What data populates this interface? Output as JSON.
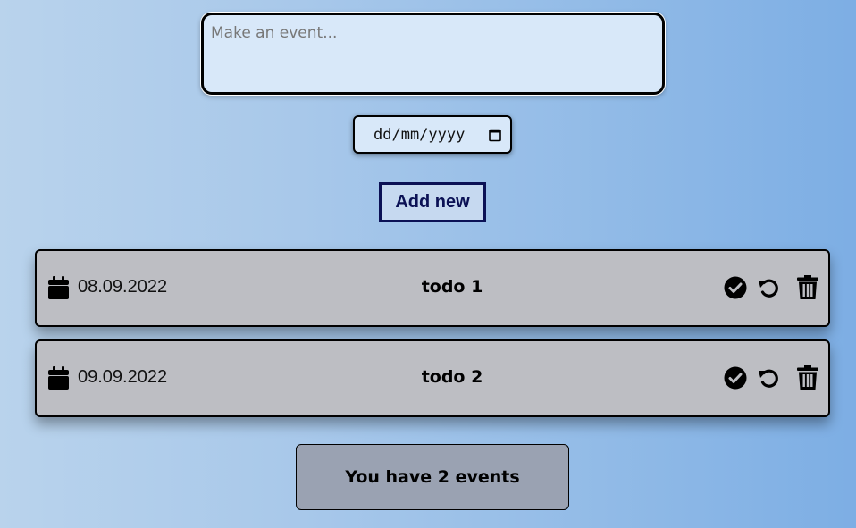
{
  "form": {
    "event_placeholder": "Make an event...",
    "event_value": "",
    "date_placeholder": "dd/mm/yyyy",
    "add_label": "Add new"
  },
  "events": [
    {
      "date": "08.09.2022",
      "title": "todo 1"
    },
    {
      "date": "09.09.2022",
      "title": "todo 2"
    }
  ],
  "icons": {
    "date": "calendar-icon",
    "complete": "check-circle-icon",
    "undo": "undo-icon",
    "delete": "trash-icon"
  },
  "counter": {
    "text": "You have 2 events"
  },
  "colors": {
    "accent": "#0b1155",
    "card_bg": "#bdbec3",
    "counter_bg": "#9aa2b2",
    "input_bg": "#d8e8f9"
  }
}
